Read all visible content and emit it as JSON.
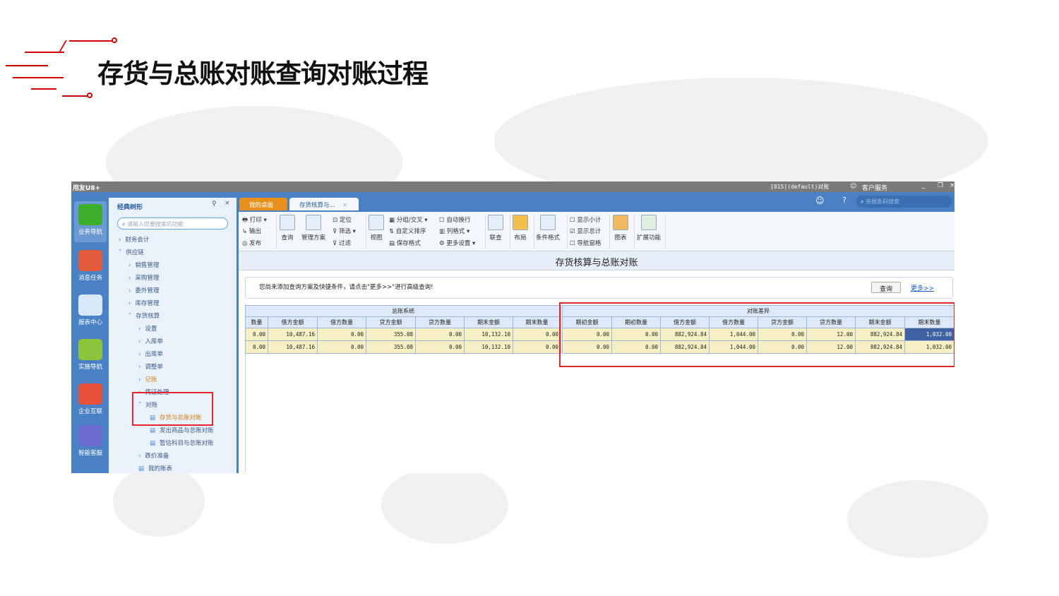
{
  "slide_title": "存货与总账对账查询对账过程",
  "window": {
    "app_name": "用友U8+",
    "account": "[015](default)对账",
    "customer_service": "客户服务",
    "search_placeholder": "单据条码搜索"
  },
  "nav": [
    "业务导航",
    "消息任务",
    "报表中心",
    "实施导航",
    "企业互联",
    "智能客服"
  ],
  "tree": {
    "title": "经典树形",
    "search_placeholder": "请输入您要搜索的功能",
    "items": [
      "财务会计",
      "供应链",
      "销售管理",
      "采购管理",
      "委外管理",
      "库存管理",
      "存货核算",
      "设置",
      "入库单",
      "出库单",
      "调整单",
      "记账",
      "凭证处理",
      "对账",
      "存货与总账对账",
      "发出商品与总账对账",
      "暂估科目与总账对账",
      "跌价准备",
      "我的账表"
    ]
  },
  "tabs": [
    "我的桌面",
    "存货核算与…"
  ],
  "toolbar": {
    "print": "打印",
    "export": "输出",
    "publish": "发布",
    "query": "查询",
    "scheme": "管理方案",
    "locate": "定位",
    "filter": "筛选",
    "filter2": "过滤",
    "view": "视图",
    "group": "分组/交叉",
    "sort": "自定义排序",
    "save_format": "保存格式",
    "auto_wrap": "自动换行",
    "col_format": "列格式",
    "more_settings": "更多设置",
    "link": "联查",
    "layout": "布局",
    "cond_format": "条件格式",
    "show_subtotal": "显示小计",
    "show_total": "显示总计",
    "nav_pane": "导航窗格",
    "chart": "图表",
    "extend": "扩展功能"
  },
  "report": {
    "title": "存货核算与总账对账",
    "hint": "您尚未添加查询方案及快捷条件，请点击\"更多>>\"进行高级查询!",
    "query_btn": "查询",
    "more_link": "更多>>"
  },
  "table": {
    "group_left": "总账系统",
    "group_right": "对账差异",
    "headers_left": [
      "数量",
      "借方金额",
      "借方数量",
      "贷方金额",
      "贷方数量",
      "期末金额",
      "期末数量"
    ],
    "headers_right": [
      "期初金额",
      "期初数量",
      "借方金额",
      "借方数量",
      "贷方金额",
      "贷方数量",
      "期末金额",
      "期末数量"
    ],
    "rows_left": [
      [
        "0.00",
        "10,487.16",
        "0.00",
        "355.08",
        "0.00",
        "10,132.10",
        "0.00"
      ],
      [
        "0.00",
        "10,487.16",
        "0.00",
        "355.08",
        "0.00",
        "10,132.10",
        "0.00"
      ]
    ],
    "rows_right": [
      [
        "0.00",
        "0.00",
        "882,924.84",
        "1,044.00",
        "0.00",
        "12.00",
        "882,924.84",
        "1,032.00"
      ],
      [
        "0.00",
        "0.00",
        "882,924.84",
        "1,044.00",
        "0.00",
        "12.00",
        "882,924.84",
        "1,032.00"
      ]
    ]
  },
  "colors": {
    "accent_red": "#e5262b",
    "ui_blue": "#4a80c4"
  }
}
